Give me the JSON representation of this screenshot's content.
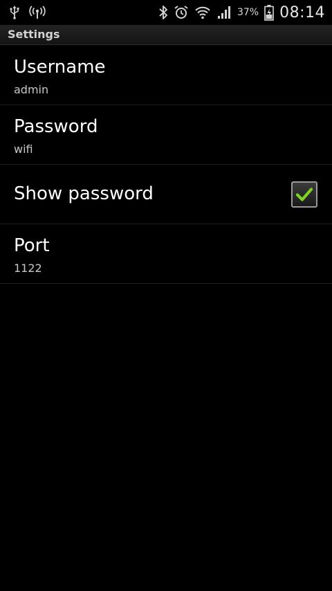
{
  "status_bar": {
    "left_icons": [
      "usb-icon",
      "wifi-hotspot-icon"
    ],
    "right_icons": [
      "bluetooth-icon",
      "alarm-icon",
      "wifi-icon",
      "signal-icon",
      "battery-charging-icon"
    ],
    "battery_percent": "37%",
    "time": "08:14"
  },
  "header": {
    "title": "Settings"
  },
  "preferences": [
    {
      "title": "Username",
      "summary": "admin"
    },
    {
      "title": "Password",
      "summary": "wifi"
    },
    {
      "title": "Show password",
      "checked": true
    },
    {
      "title": "Port",
      "summary": "1122"
    }
  ],
  "colors": {
    "background": "#000000",
    "title_bar": "#1b1b1b",
    "check_mark": "#7ed321",
    "divider": "#1e1e1e"
  }
}
